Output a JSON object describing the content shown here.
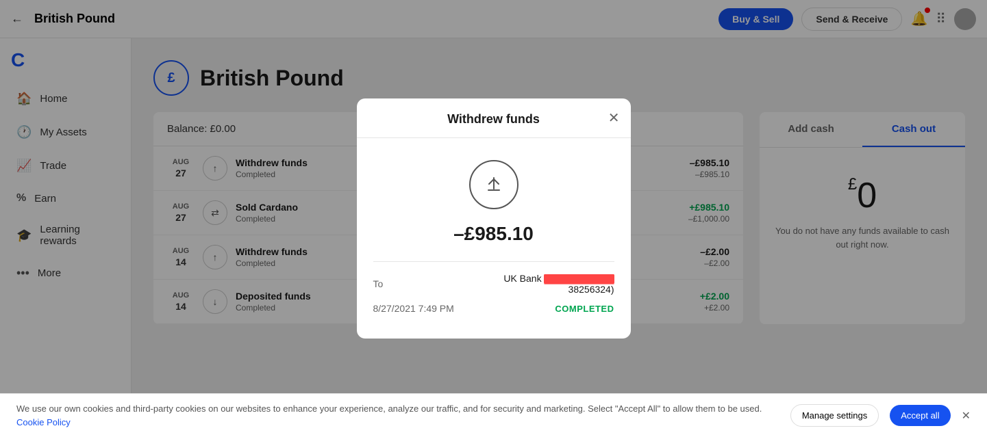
{
  "app": {
    "logo": "C",
    "logo_color": "#1652f0"
  },
  "topnav": {
    "back_label": "←",
    "title": "British Pound",
    "buy_sell_label": "Buy & Sell",
    "send_receive_label": "Send & Receive"
  },
  "sidebar": {
    "items": [
      {
        "id": "home",
        "label": "Home",
        "icon": "🏠"
      },
      {
        "id": "my-assets",
        "label": "My Assets",
        "icon": "🕐"
      },
      {
        "id": "trade",
        "label": "Trade",
        "icon": "📈"
      },
      {
        "id": "earn",
        "label": "Earn",
        "icon": "%"
      },
      {
        "id": "learning-rewards",
        "label": "Learning rewards",
        "icon": "🎓"
      },
      {
        "id": "more",
        "label": "More",
        "icon": "•••"
      }
    ]
  },
  "page": {
    "coin_symbol": "£",
    "title": "British Pound"
  },
  "balance_bar": {
    "label": "Balance: £0.00"
  },
  "transactions": [
    {
      "month": "AUG",
      "day": "27",
      "icon_type": "withdraw",
      "name": "Withdrew funds",
      "status": "Completed",
      "amount_primary": "–£985.10",
      "amount_secondary": "–£985.10",
      "positive": false
    },
    {
      "month": "AUG",
      "day": "27",
      "icon_type": "swap",
      "name": "Sold Cardano",
      "status": "Completed",
      "amount_primary": "+£985.10",
      "amount_secondary": "–£1,000.00",
      "positive": true
    },
    {
      "month": "AUG",
      "day": "14",
      "icon_type": "withdraw",
      "name": "Withdrew funds",
      "status": "Completed",
      "amount_primary": "–£2.00",
      "amount_secondary": "–£2.00",
      "positive": false
    },
    {
      "month": "AUG",
      "day": "14",
      "icon_type": "deposit",
      "name": "Deposited funds",
      "status": "Completed",
      "amount_primary": "+£2.00",
      "amount_secondary": "+£2.00",
      "positive": true
    }
  ],
  "right_panel": {
    "tab_add_cash": "Add cash",
    "tab_cash_out": "Cash out",
    "active_tab": "cash_out",
    "balance_currency": "£",
    "balance_amount": "0",
    "balance_note": "You do not have any funds available to cash out right now."
  },
  "modal": {
    "title": "Withdrew funds",
    "amount": "–£985.10",
    "to_label": "To",
    "to_value": "UK Bank ••••••••••38256324)",
    "datetime": "8/27/2021 7:49 PM",
    "status": "COMPLETED"
  },
  "cookie": {
    "text": "We use our own cookies and third-party cookies on our websites to enhance your experience, analyze our traffic, and for security and marketing. Select \"Accept All\" to allow them to be used.",
    "link_text": "Cookie Policy",
    "manage_label": "Manage settings",
    "accept_label": "Accept all"
  }
}
